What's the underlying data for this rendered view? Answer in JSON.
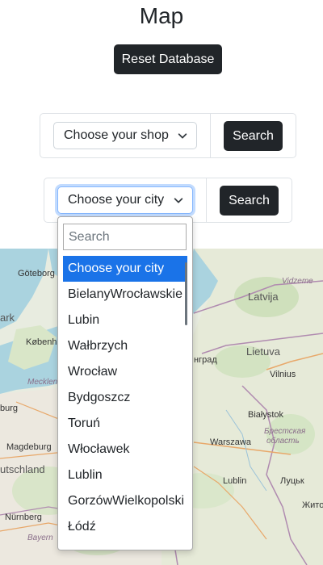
{
  "header": {
    "title": "Map"
  },
  "actions": {
    "reset_label": "Reset Database"
  },
  "shop_form": {
    "select_value": "Choose your shop",
    "search_label": "Search"
  },
  "city_form": {
    "select_value": "Choose your city",
    "search_label": "Search"
  },
  "city_dropdown": {
    "search_placeholder": "Search",
    "options": [
      "Choose your city",
      "BielanyWrocławskie",
      "Lubin",
      "Wałbrzych",
      "Wrocław",
      "Bydgoszcz",
      "Toruń",
      "Włocławek",
      "Lublin",
      "GorzówWielkopolski",
      "Łódź"
    ],
    "selected_index": 0
  },
  "map": {
    "labels": {
      "goteborg": "Göteborg",
      "latvija": "Latvija",
      "vidzeme": "Vidzeme",
      "ark": "ark",
      "kobenhavn": "København",
      "lietuva": "Lietuva",
      "vilnius": "Vilnius",
      "grad": "нград",
      "mecklen": "Mecklen",
      "burg": "burg",
      "bialystok": "Białystok",
      "warszawa": "Warszawa",
      "brest": "Брестская",
      "oblast": "область",
      "magdeburg": "Magdeburg",
      "utschland": "utschland",
      "lublin": "Lublin",
      "lutsk": "Луцьк",
      "nurnberg": "Nürnberg",
      "zhyto": "Жито",
      "bayern": "Bayern"
    }
  }
}
